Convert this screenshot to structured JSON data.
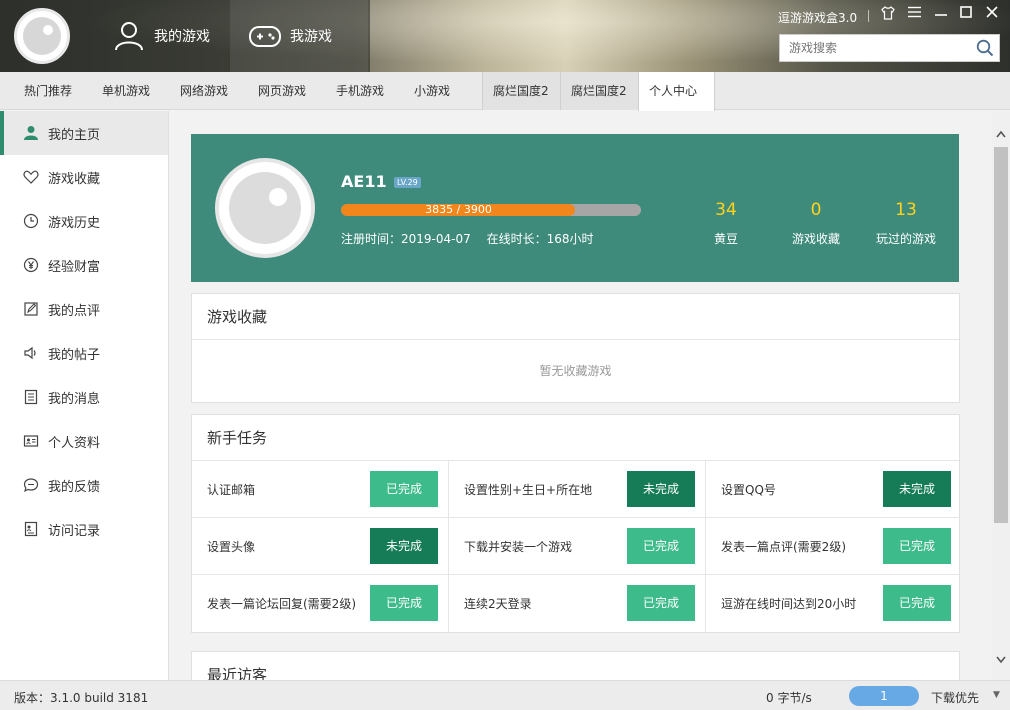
{
  "app": {
    "title": "逗游游戏盒3.0",
    "top_nav": [
      {
        "label": "我的游戏",
        "icon": "user-icon"
      },
      {
        "label": "我游戏",
        "icon": "gamepad-icon"
      }
    ],
    "window_controls": [
      "shirt-icon",
      "menu-icon",
      "minimize-icon",
      "maximize-icon",
      "close-icon"
    ],
    "search": {
      "placeholder": "游戏搜索"
    }
  },
  "tabs": [
    {
      "label": "热门推荐"
    },
    {
      "label": "单机游戏"
    },
    {
      "label": "网络游戏"
    },
    {
      "label": "网页游戏"
    },
    {
      "label": "手机游戏"
    },
    {
      "label": "小游戏"
    },
    {
      "label": "腐烂国度2"
    },
    {
      "label": "腐烂国度2"
    },
    {
      "label": "个人中心",
      "active": true
    }
  ],
  "sidebar": {
    "items": [
      {
        "label": "我的主页",
        "icon": "user-icon",
        "active": true
      },
      {
        "label": "游戏收藏",
        "icon": "heart-icon"
      },
      {
        "label": "游戏历史",
        "icon": "clock-icon"
      },
      {
        "label": "经验财富",
        "icon": "yen-icon"
      },
      {
        "label": "我的点评",
        "icon": "edit-icon"
      },
      {
        "label": "我的帖子",
        "icon": "speaker-icon"
      },
      {
        "label": "我的消息",
        "icon": "document-icon"
      },
      {
        "label": "个人资料",
        "icon": "id-card-icon"
      },
      {
        "label": "我的反馈",
        "icon": "chat-icon"
      },
      {
        "label": "访问记录",
        "icon": "record-icon"
      }
    ]
  },
  "profile": {
    "username": "AE11",
    "level": "LV.29",
    "exp_text": "3835 / 3900",
    "exp_fraction": 0.78,
    "register_label": "注册时间：2019-04-07",
    "online_label": "在线时长：168小时",
    "stats": [
      {
        "value": "34",
        "label": "黄豆"
      },
      {
        "value": "0",
        "label": "游戏收藏"
      },
      {
        "value": "13",
        "label": "玩过的游戏"
      }
    ]
  },
  "favorites": {
    "title": "游戏收藏",
    "empty_text": "暂无收藏游戏"
  },
  "tasks": {
    "title": "新手任务",
    "items": [
      {
        "name": "认证邮箱",
        "status": "已完成",
        "done": true
      },
      {
        "name": "设置性别+生日+所在地",
        "status": "未完成",
        "done": false
      },
      {
        "name": "设置QQ号",
        "status": "未完成",
        "done": false
      },
      {
        "name": "设置头像",
        "status": "未完成",
        "done": false
      },
      {
        "name": "下载并安装一个游戏",
        "status": "已完成",
        "done": true
      },
      {
        "name": "发表一篇点评(需要2级)",
        "status": "已完成",
        "done": true
      },
      {
        "name": "发表一篇论坛回复(需要2级)",
        "status": "已完成",
        "done": true
      },
      {
        "name": "连续2天登录",
        "status": "已完成",
        "done": true
      },
      {
        "name": "逗游在线时间达到20小时",
        "status": "已完成",
        "done": true
      }
    ]
  },
  "visitors": {
    "title": "最近访客"
  },
  "status_bar": {
    "version": "版本：3.1.0 build 3181",
    "speed": "0 字节/s",
    "download_count": "1",
    "priority": "下载优先"
  },
  "colors": {
    "accent": "#2f8d6e",
    "profile_bg": "#3e8b7c",
    "done_button": "#3dbb8b",
    "todo_button": "#167c58",
    "exp_fill": "#f0861c",
    "stat_number": "#ffd21c"
  }
}
